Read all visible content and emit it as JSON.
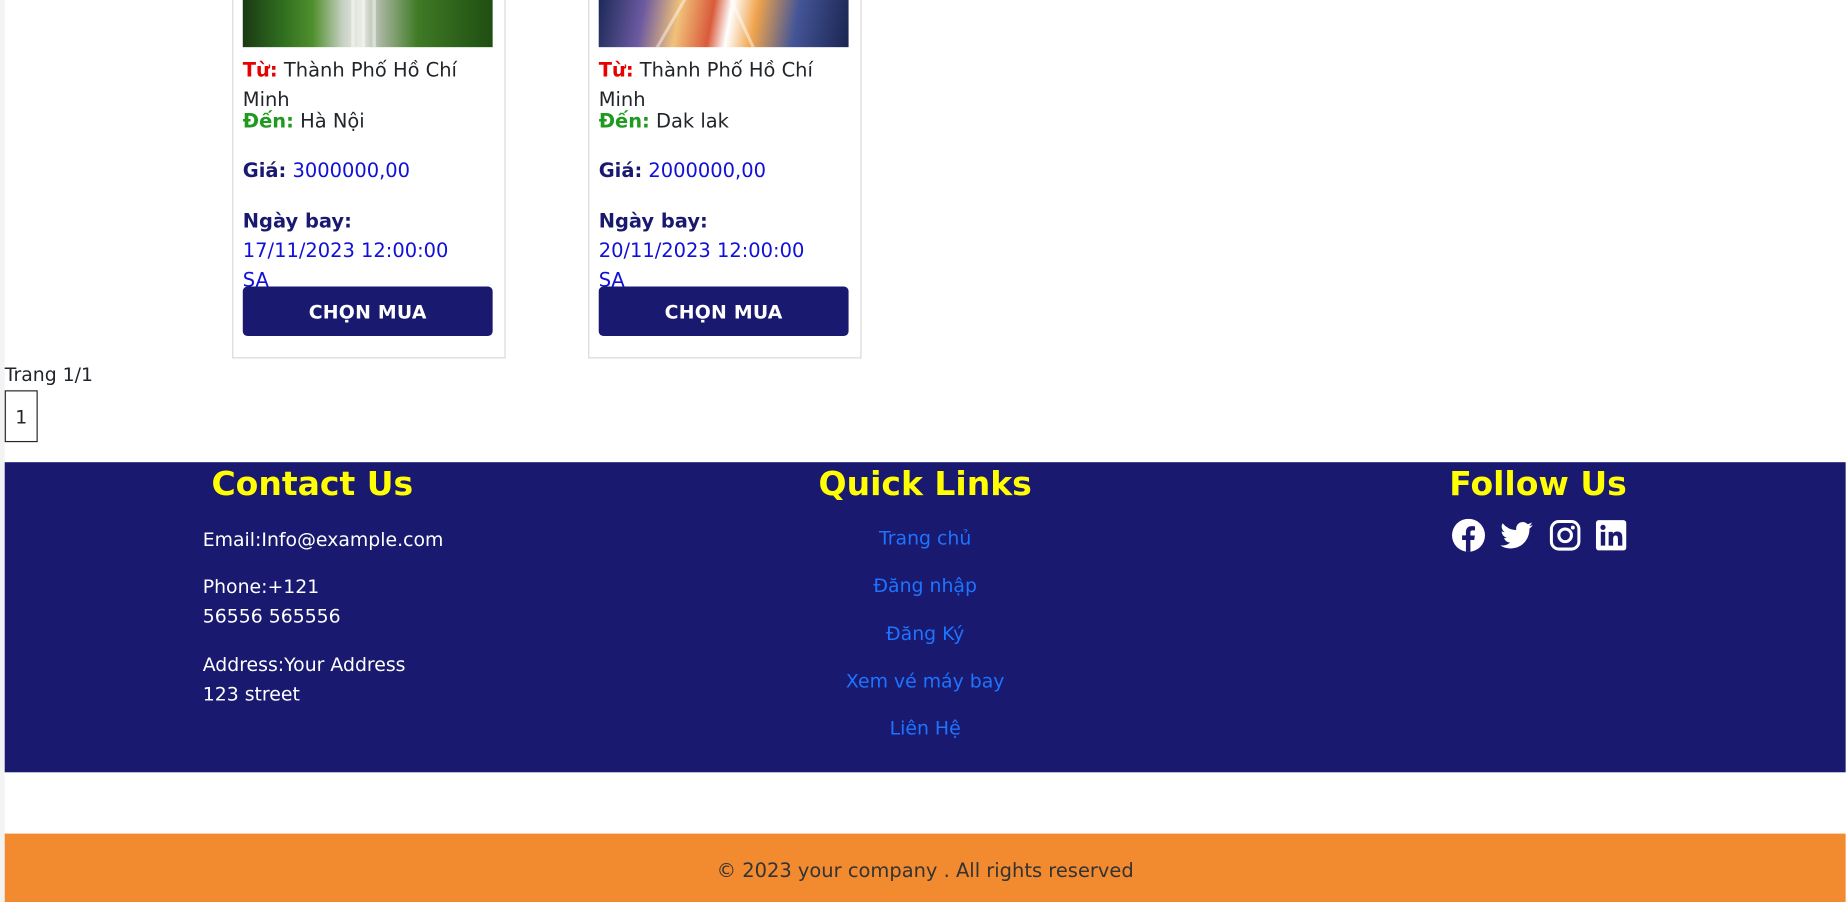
{
  "cards": [
    {
      "from_label": "Từ:",
      "from_value": "Thành Phố Hồ Chí Minh",
      "to_label": "Đến:",
      "to_value": "Hà Nội",
      "price_label": "Giá:",
      "price_value": "3000000,00",
      "date_label": "Ngày bay:",
      "date_value": "17/11/2023 12:00:00 SA",
      "button_label": "CHỌN MUA"
    },
    {
      "from_label": "Từ:",
      "from_value": "Thành Phố Hồ Chí Minh",
      "to_label": "Đến:",
      "to_value": "Dak lak",
      "price_label": "Giá:",
      "price_value": "2000000,00",
      "date_label": "Ngày bay:",
      "date_value": "20/11/2023 12:00:00 SA",
      "button_label": "CHỌN MUA"
    }
  ],
  "pagination": {
    "info": "Trang 1/1",
    "current_page": "1"
  },
  "footer": {
    "contact": {
      "title": "Contact Us",
      "email": "Email:Info@example.com",
      "phone": "Phone:+121 56556 565556",
      "address": "Address:Your Address 123 street"
    },
    "quick_links": {
      "title": "Quick Links",
      "items": [
        "Trang chủ",
        "Đăng nhập",
        "Đăng Ký",
        "Xem vé máy bay",
        "Liên Hệ"
      ]
    },
    "follow": {
      "title": "Follow Us",
      "icons": [
        "facebook-icon",
        "twitter-icon",
        "instagram-icon",
        "linkedin-icon"
      ]
    },
    "copyright": "© 2023 your company . All rights reserved"
  },
  "colors": {
    "navy": "#191970",
    "heading_yellow": "#ffff00",
    "link_blue": "#1e74ff",
    "copyright_orange": "#f28a30",
    "from_red": "#e60000",
    "to_green": "#1f9a1f"
  }
}
